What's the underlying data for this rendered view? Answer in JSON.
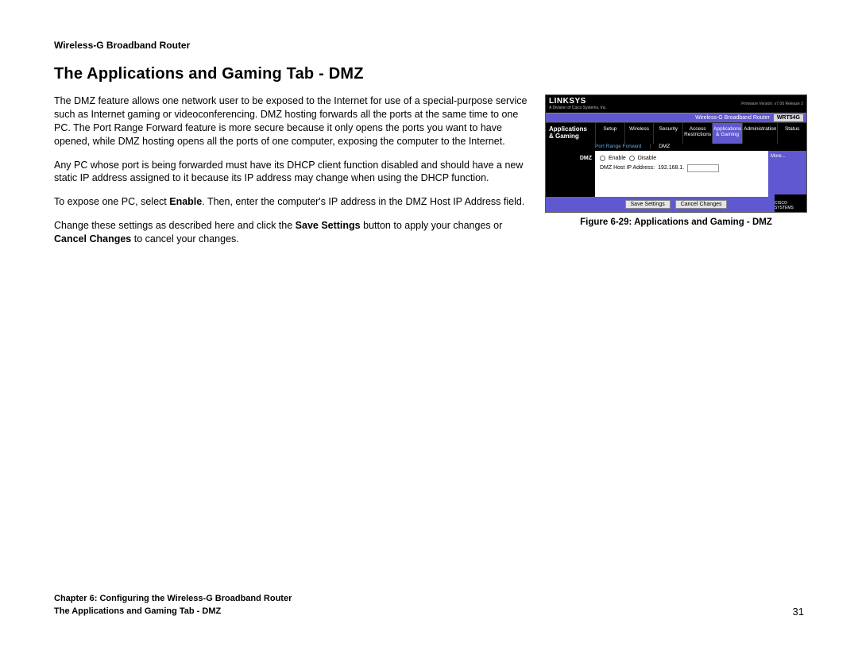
{
  "header": {
    "product": "Wireless-G Broadband Router"
  },
  "section": {
    "title": "The Applications and Gaming Tab - DMZ"
  },
  "paragraphs": {
    "p1": "The DMZ feature allows one network user to be exposed to the Internet for use of a special-purpose service such as Internet gaming or videoconferencing. DMZ hosting forwards all the ports at the same time to one PC. The Port Range Forward feature is more secure because it only opens the ports you want to have opened, while DMZ hosting opens all the ports of one computer, exposing the computer to the Internet.",
    "p2": "Any PC whose port is being forwarded must have its DHCP client function disabled and should have a new static IP address assigned to it because its IP address may change when using the DHCP function.",
    "p3a": "To expose one PC, select ",
    "p3b_bold": "Enable",
    "p3c": ". Then, enter the computer's IP address in the DMZ Host IP Address field.",
    "p4a": "Change these settings as described here and click the ",
    "p4b_bold": "Save Settings",
    "p4c": " button to apply your changes or ",
    "p4d_bold": "Cancel Changes",
    "p4e": " to cancel your changes."
  },
  "figure": {
    "caption": "Figure 6-29: Applications and Gaming - DMZ",
    "ui": {
      "logo": "LINKSYS",
      "sublogo": "A Division of Cisco Systems, Inc.",
      "firmware": "Firmware Version: v7.00 Release 2",
      "modeltitle": "Wireless-G Broadband Router",
      "modelno": "WRT54G",
      "sidelabel": "Applications & Gaming",
      "tabs": [
        "Setup",
        "Wireless",
        "Security",
        "Access Restrictions",
        "Applications & Gaming",
        "Administration",
        "Status"
      ],
      "subtabs": {
        "a": "Port Range Forward",
        "sep": "|",
        "b": "DMZ"
      },
      "bodylabel": "DMZ",
      "enable": "Enable",
      "disable": "Disable",
      "hostlabel": "DMZ Host IP Address:",
      "hostvalue": "192.168.1.",
      "more": "More...",
      "save": "Save Settings",
      "cancel": "Cancel Changes",
      "cisco": "CISCO SYSTEMS"
    }
  },
  "footer": {
    "chapter": "Chapter 6: Configuring the Wireless-G Broadband Router",
    "section": "The Applications and Gaming Tab - DMZ",
    "page": "31"
  }
}
